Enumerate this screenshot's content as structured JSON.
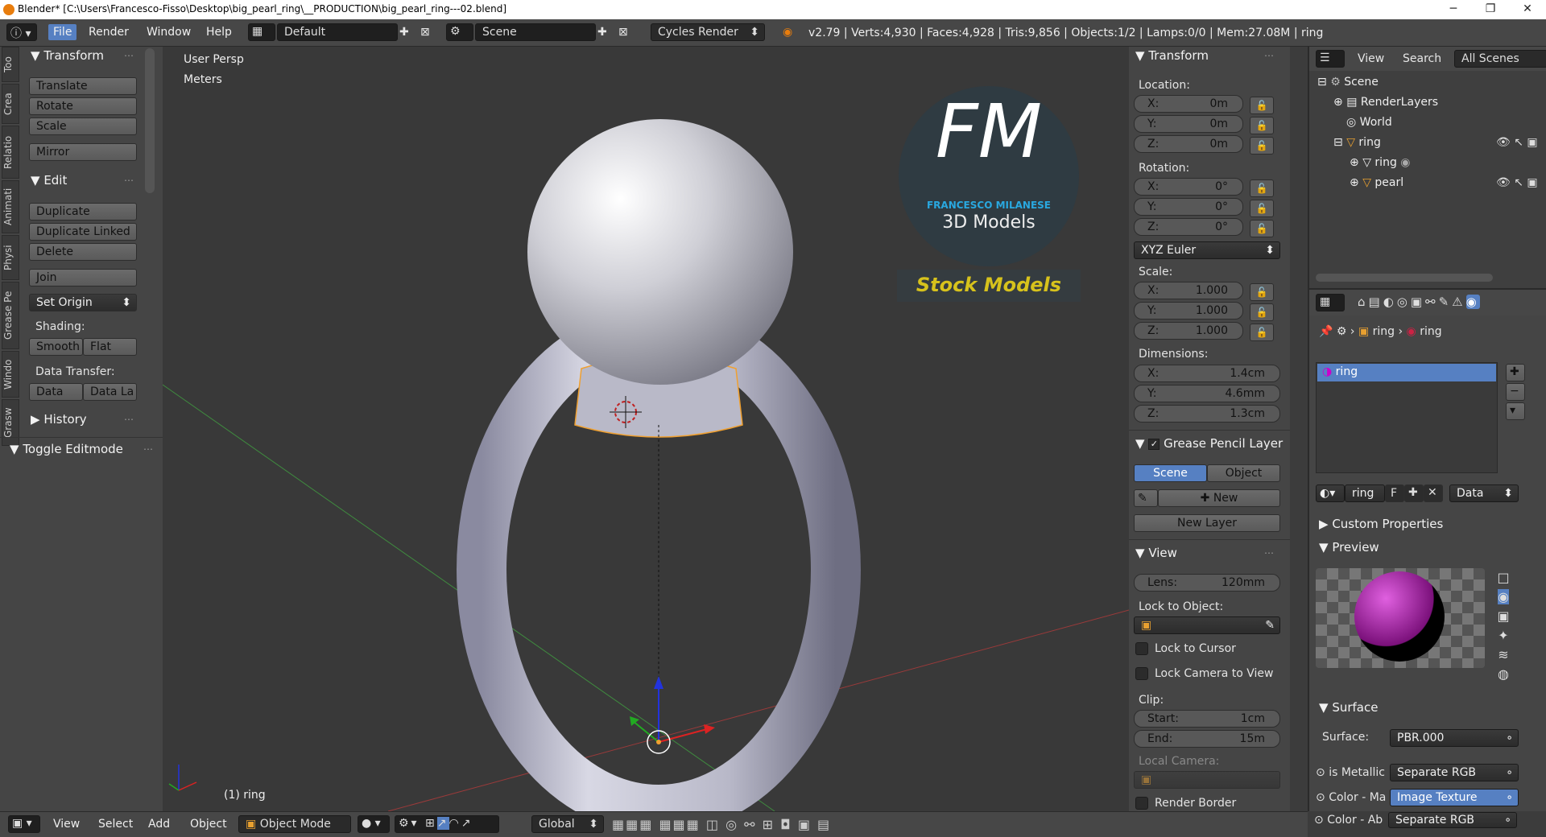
{
  "window": {
    "title": "Blender* [C:\\Users\\Francesco-Fisso\\Desktop\\big_pearl_ring\\__PRODUCTION\\big_pearl_ring---02.blend]"
  },
  "menubar": {
    "items": [
      "File",
      "Render",
      "Window",
      "Help"
    ],
    "layout": "Default",
    "scene": "Scene",
    "engine": "Cycles Render",
    "stats": "v2.79 | Verts:4,930 | Faces:4,928 | Tris:9,856 | Objects:1/2 | Lamps:0/0 | Mem:27.08M | ring"
  },
  "toolshelf": {
    "tabs": [
      "Too",
      "Crea",
      "Relatio",
      "Animati",
      "Physi",
      "Grease Pe",
      "Windo",
      "Grasw"
    ],
    "transform_title": "Transform",
    "translate": "Translate",
    "rotate": "Rotate",
    "scale": "Scale",
    "mirror": "Mirror",
    "edit_title": "Edit",
    "duplicate": "Duplicate",
    "duplicate_linked": "Duplicate Linked",
    "delete": "Delete",
    "join": "Join",
    "set_origin": "Set Origin",
    "shading_label": "Shading:",
    "smooth": "Smooth",
    "flat": "Flat",
    "data_transfer_label": "Data Transfer:",
    "data": "Data",
    "data_la": "Data La",
    "history": "History",
    "toggle_editmode": "Toggle Editmode"
  },
  "viewport": {
    "view_name": "User Persp",
    "units": "Meters",
    "object_label": "(1) ring",
    "logo_initials": "FM",
    "logo_name": "FRANCESCO MILANESE",
    "logo_sub": "3D Models",
    "logo_tag": "Stock Models"
  },
  "properties": {
    "transform_title": "Transform",
    "location_label": "Location:",
    "loc": [
      {
        "k": "X:",
        "v": "0m"
      },
      {
        "k": "Y:",
        "v": "0m"
      },
      {
        "k": "Z:",
        "v": "0m"
      }
    ],
    "rotation_label": "Rotation:",
    "rot": [
      {
        "k": "X:",
        "v": "0°"
      },
      {
        "k": "Y:",
        "v": "0°"
      },
      {
        "k": "Z:",
        "v": "0°"
      }
    ],
    "rot_mode": "XYZ Euler",
    "scale_label": "Scale:",
    "scl": [
      {
        "k": "X:",
        "v": "1.000"
      },
      {
        "k": "Y:",
        "v": "1.000"
      },
      {
        "k": "Z:",
        "v": "1.000"
      }
    ],
    "dim_label": "Dimensions:",
    "dim": [
      {
        "k": "X:",
        "v": "1.4cm"
      },
      {
        "k": "Y:",
        "v": "4.6mm"
      },
      {
        "k": "Z:",
        "v": "1.3cm"
      }
    ],
    "gp_title": "Grease Pencil Layer",
    "gp_scene": "Scene",
    "gp_object": "Object",
    "gp_new": "New",
    "gp_new_layer": "New Layer",
    "view_title": "View",
    "lens_label": "Lens:",
    "lens": "120mm",
    "lock_obj_label": "Lock to Object:",
    "lock_cursor": "Lock to Cursor",
    "lock_camera": "Lock Camera to View",
    "clip_label": "Clip:",
    "clip_start_k": "Start:",
    "clip_start": "1cm",
    "clip_end_k": "End:",
    "clip_end": "15m",
    "local_camera": "Local Camera:",
    "render_border": "Render Border"
  },
  "outliner": {
    "view": "View",
    "search": "Search",
    "scenes": "All Scenes",
    "items": [
      "Scene",
      "RenderLayers",
      "World",
      "ring",
      "ring",
      "pearl"
    ]
  },
  "material": {
    "breadcrumb_obj": "ring",
    "breadcrumb_mat": "ring",
    "slot": "ring",
    "mat_name": "ring",
    "f": "F",
    "data": "Data",
    "custom_props": "Custom Properties",
    "preview": "Preview",
    "surface_title": "Surface",
    "surface_label": "Surface:",
    "surface_value": "PBR.000",
    "rows": [
      {
        "k": "is Metallic",
        "v": "Separate RGB"
      },
      {
        "k": "Color - Ma",
        "v": "Image Texture"
      },
      {
        "k": "Color - Ab",
        "v": "Separate RGB"
      }
    ]
  },
  "bottombar": {
    "view": "View",
    "select": "Select",
    "add": "Add",
    "object": "Object",
    "mode": "Object Mode",
    "orientation": "Global"
  },
  "colors": {
    "accent": "#5680c2",
    "selection": "#f0a030",
    "logo_blue": "#29a8e0",
    "logo_yellow": "#d7c21c"
  }
}
